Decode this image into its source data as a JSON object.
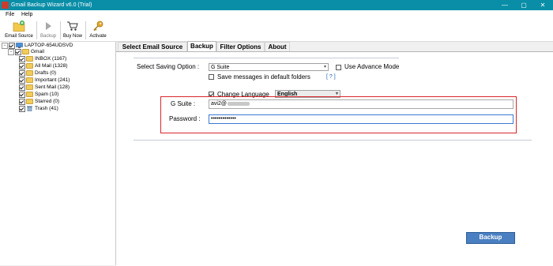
{
  "window": {
    "title": "Gmail Backup Wizard v6.0 (Trial)",
    "controls": {
      "minimize": "—",
      "maximize": "▢",
      "close": "✕"
    }
  },
  "menu": {
    "items": [
      "File",
      "Help"
    ]
  },
  "toolbar": {
    "email_source": "Email Source",
    "backup": "Backup",
    "buy_now": "Buy Now",
    "activate": "Activate"
  },
  "tree": {
    "root": "LAPTOP-654UDSVD",
    "account": "Gmail",
    "folders": [
      {
        "label": "INBOX (1167)"
      },
      {
        "label": "All Mail (1328)"
      },
      {
        "label": "Drafts (0)"
      },
      {
        "label": "Important (241)"
      },
      {
        "label": "Sent Mail (128)"
      },
      {
        "label": "Spam (10)"
      },
      {
        "label": "Starred (0)"
      },
      {
        "label": "Trash (41)"
      }
    ]
  },
  "tabs": [
    "Select Email Source",
    "Backup",
    "Filter Options",
    "About"
  ],
  "active_tab": "Backup",
  "backup": {
    "saving_option_label": "Select Saving Option :",
    "saving_option_value": "G Suite",
    "advance_mode_label": "Use Advance Mode",
    "default_folders_label": "Save messages in default folders",
    "help_link": "[ ? ]",
    "change_language_label": "Change Language",
    "language_value": "English",
    "gsuite_label": "G Suite  :",
    "gsuite_value": "avi2@",
    "password_label": "Password :",
    "password_value": "•••••••••••••",
    "backup_button": "Backup"
  },
  "colors": {
    "titlebar": "#0a8ea8",
    "highlight_border": "#d9262b",
    "button_fill": "#4a7fc1"
  }
}
